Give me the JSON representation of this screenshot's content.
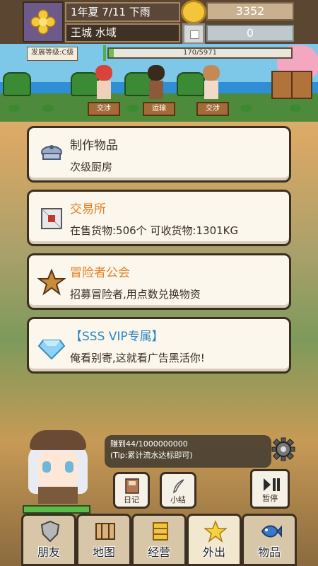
{
  "header": {
    "date": "1年夏 7/11 下雨",
    "location": "王城 水域",
    "gold": "3352",
    "silver": "0"
  },
  "shop": {
    "rank_label": "发展等级:C级",
    "exp_text": "170/5971",
    "exp_progress": 0.0285,
    "stand_labels": [
      "交涉",
      "运输",
      "交涉"
    ]
  },
  "menu": [
    {
      "title": "制作物品",
      "subtitle": "次级厨房",
      "icon": "bowl-icon"
    },
    {
      "title": "交易所",
      "subtitle": "在售货物:506个   可收货物:1301KG",
      "icon": "crate-icon"
    },
    {
      "title": "冒险者公会",
      "subtitle": "招募冒险者,用点数兑换物资",
      "icon": "star-icon"
    },
    {
      "title": "【SSS VIP专属】",
      "subtitle": "俺看别寄,这就看广告黑活你!",
      "icon": "diamond-icon"
    }
  ],
  "info": {
    "line1": "赚到44/1000000000",
    "line2": "(Tip:累计流水达标即可)"
  },
  "buttons": {
    "diary": "日记",
    "summary": "小结",
    "pause": "暂停"
  },
  "nav": [
    "朋友",
    "地图",
    "经营",
    "外出",
    "物品"
  ],
  "colors": {
    "card_bg": "#fbf7ed",
    "accent_orange": "#e67e22",
    "accent_blue": "#2e86c1",
    "border": "#3d2e22"
  }
}
